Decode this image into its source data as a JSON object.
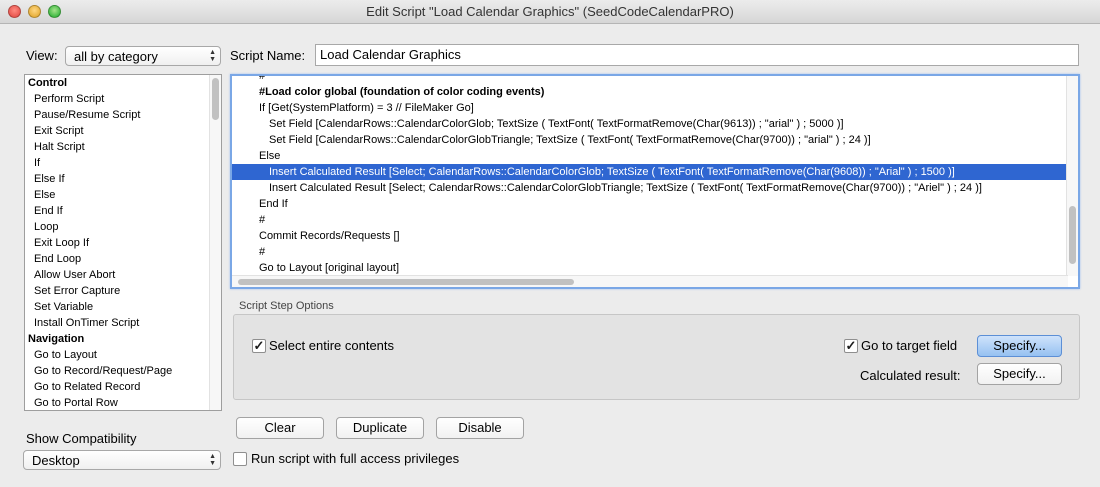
{
  "window": {
    "title": "Edit Script \"Load Calendar Graphics\" (SeedCodeCalendarPRO)"
  },
  "view": {
    "label": "View:",
    "selected": "all by category"
  },
  "script_name": {
    "label": "Script Name:",
    "value": "Load Calendar Graphics"
  },
  "steps_list": [
    {
      "text": "Control",
      "category": true
    },
    {
      "text": "Perform Script"
    },
    {
      "text": "Pause/Resume Script"
    },
    {
      "text": "Exit Script"
    },
    {
      "text": "Halt Script"
    },
    {
      "text": "If"
    },
    {
      "text": "Else If"
    },
    {
      "text": "Else"
    },
    {
      "text": "End If"
    },
    {
      "text": "Loop"
    },
    {
      "text": "Exit Loop If"
    },
    {
      "text": "End Loop"
    },
    {
      "text": "Allow User Abort"
    },
    {
      "text": "Set Error Capture"
    },
    {
      "text": "Set Variable"
    },
    {
      "text": "Install OnTimer Script"
    },
    {
      "text": "Navigation",
      "category": true
    },
    {
      "text": "Go to Layout"
    },
    {
      "text": "Go to Record/Request/Page"
    },
    {
      "text": "Go to Related Record"
    },
    {
      "text": "Go to Portal Row"
    }
  ],
  "script_lines": [
    {
      "text": "#",
      "indent": 0
    },
    {
      "text": "#Load color global (foundation of color coding events)",
      "indent": 0,
      "bold": true
    },
    {
      "text": "If [Get(SystemPlatform) = 3 // FileMaker Go]",
      "indent": 0
    },
    {
      "text": "Set Field [CalendarRows::CalendarColorGlob; TextSize ( TextFont( TextFormatRemove(Char(9613)) ; \"arial\" ) ; 5000 )]",
      "indent": 1
    },
    {
      "text": "Set Field [CalendarRows::CalendarColorGlobTriangle; TextSize ( TextFont( TextFormatRemove(Char(9700)) ; \"arial\" ) ; 24 )]",
      "indent": 1
    },
    {
      "text": "Else",
      "indent": 0
    },
    {
      "text": "Insert Calculated Result [Select; CalendarRows::CalendarColorGlob; TextSize ( TextFont( TextFormatRemove(Char(9608)) ; \"Arial\" ) ; 1500 )]",
      "indent": 1,
      "selected": true
    },
    {
      "text": "Insert Calculated Result [Select; CalendarRows::CalendarColorGlobTriangle; TextSize ( TextFont( TextFormatRemove(Char(9700)) ; \"Ariel\" ) ; 24 )]",
      "indent": 1
    },
    {
      "text": "End If",
      "indent": 0
    },
    {
      "text": "#",
      "indent": 0
    },
    {
      "text": "Commit Records/Requests []",
      "indent": 0
    },
    {
      "text": "#",
      "indent": 0
    },
    {
      "text": "Go to Layout [original layout]",
      "indent": 0
    }
  ],
  "options": {
    "section_title": "Script Step Options",
    "select_entire": {
      "label": "Select entire contents",
      "checked": true
    },
    "target_field": {
      "label": "Go to target field",
      "checked": true,
      "button": "Specify..."
    },
    "calculated_result": {
      "label": "Calculated result:",
      "button": "Specify..."
    }
  },
  "buttons": {
    "clear": "Clear",
    "duplicate": "Duplicate",
    "disable": "Disable"
  },
  "compatibility": {
    "label": "Show Compatibility",
    "selected": "Desktop"
  },
  "full_access": {
    "label": "Run script with full access privileges",
    "checked": false
  },
  "colors": {
    "selection": "#2f66d1",
    "focus_ring": "#7aa7e6",
    "default_button": "#96c1f1"
  }
}
